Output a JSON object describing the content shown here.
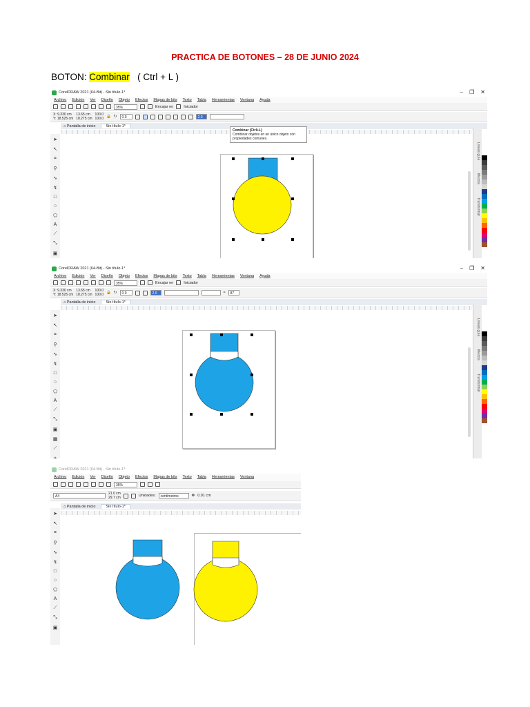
{
  "document": {
    "title": "PRACTICA DE BOTONES – 28 DE JUNIO 2024",
    "boton_prefix": "BOTON:",
    "boton_name": "Combinar",
    "shortcut": "( Ctrl + L )"
  },
  "app": {
    "window_title": "CorelDRAW 2021 (64-Bit) - Sin título-1*",
    "menu": [
      "Archivo",
      "Edición",
      "Ver",
      "Diseño",
      "Objeto",
      "Efectos",
      "Mapas de bits",
      "Texto",
      "Tabla",
      "Herramientas",
      "Ventana",
      "Ayuda"
    ],
    "zoom": "35%",
    "snap_label": "Encajar en",
    "launch_label": "Iniciador",
    "pos_x": "X: 9.330 cm",
    "pos_y": "Y: 18.525 cm",
    "size_w": "13.65 cm",
    "size_h": "18.275 cm",
    "scale_w": "100.0",
    "scale_h": "100.0",
    "percent": "%",
    "angle": "0.0",
    "outline": "2.0 pt",
    "home_tab": "Pantalla de inicio",
    "doc_tab": "Sin título-1*",
    "ruler_unit": "centímetros",
    "dock_tabs": [
      "Líneas guía",
      "Mezcla",
      "Transformar"
    ],
    "tooltip_title": "Combinar (Ctrl+L)",
    "tooltip_text": "Combinar objetos en un único objeto con propiedades comunes.",
    "page_size": "A4",
    "page_w": "21.0 cm",
    "page_h": "29.7 cm",
    "units_label": "Unidades:",
    "units_value": "centímetros",
    "nudge": "0.01 cm",
    "angle_value": "87"
  },
  "colors": {
    "title_red": "#d40000",
    "highlight": "#ffff00",
    "shape_yellow": "#fff200",
    "shape_blue": "#1ea3e6",
    "palette": [
      "#ffffff",
      "#000000",
      "#3c3c3c",
      "#5a5a5a",
      "#7a7a7a",
      "#9a9a9a",
      "#bdbdbd",
      "#d8d8d8",
      "#1f3b8a",
      "#0070c0",
      "#00a0e0",
      "#00b050",
      "#92d050",
      "#ffff00",
      "#ffc000",
      "#ff6600",
      "#ff0000",
      "#e0007a",
      "#7030a0",
      "#a0522d"
    ]
  }
}
